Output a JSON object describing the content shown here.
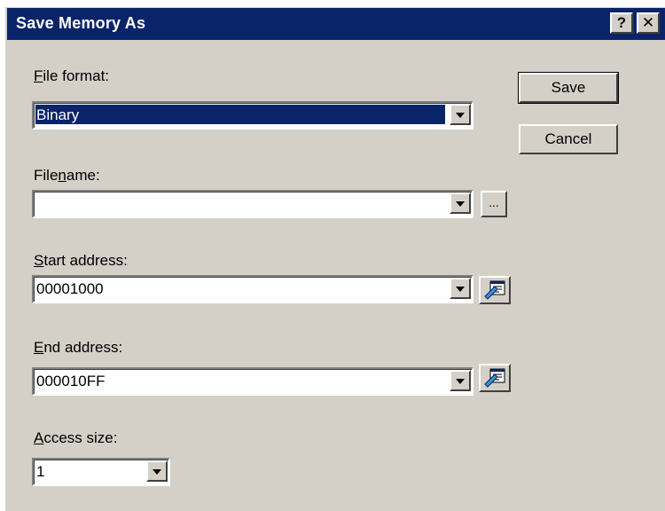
{
  "window": {
    "title": "Save Memory As",
    "help_glyph": "?",
    "close_glyph": "✕"
  },
  "file_format": {
    "label_prefix": "",
    "label_mnemonic": "F",
    "label_rest": "ile format:",
    "value": "Binary"
  },
  "filename": {
    "label_prefix": "File",
    "label_mnemonic": "n",
    "label_rest": "ame:",
    "value": "",
    "browse_label": "..."
  },
  "start_address": {
    "label_prefix": "",
    "label_mnemonic": "S",
    "label_rest": "tart address:",
    "value": "00001000"
  },
  "end_address": {
    "label_prefix": "",
    "label_mnemonic": "E",
    "label_rest": "nd address:",
    "value": "000010FF"
  },
  "access_size": {
    "label_prefix": "",
    "label_mnemonic": "A",
    "label_rest": "ccess size:",
    "value": "1"
  },
  "buttons": {
    "save": "Save",
    "cancel": "Cancel"
  },
  "colors": {
    "titlebar": "#0a246a",
    "dialog_face": "#d4d0c8",
    "selection": "#0a246a"
  }
}
